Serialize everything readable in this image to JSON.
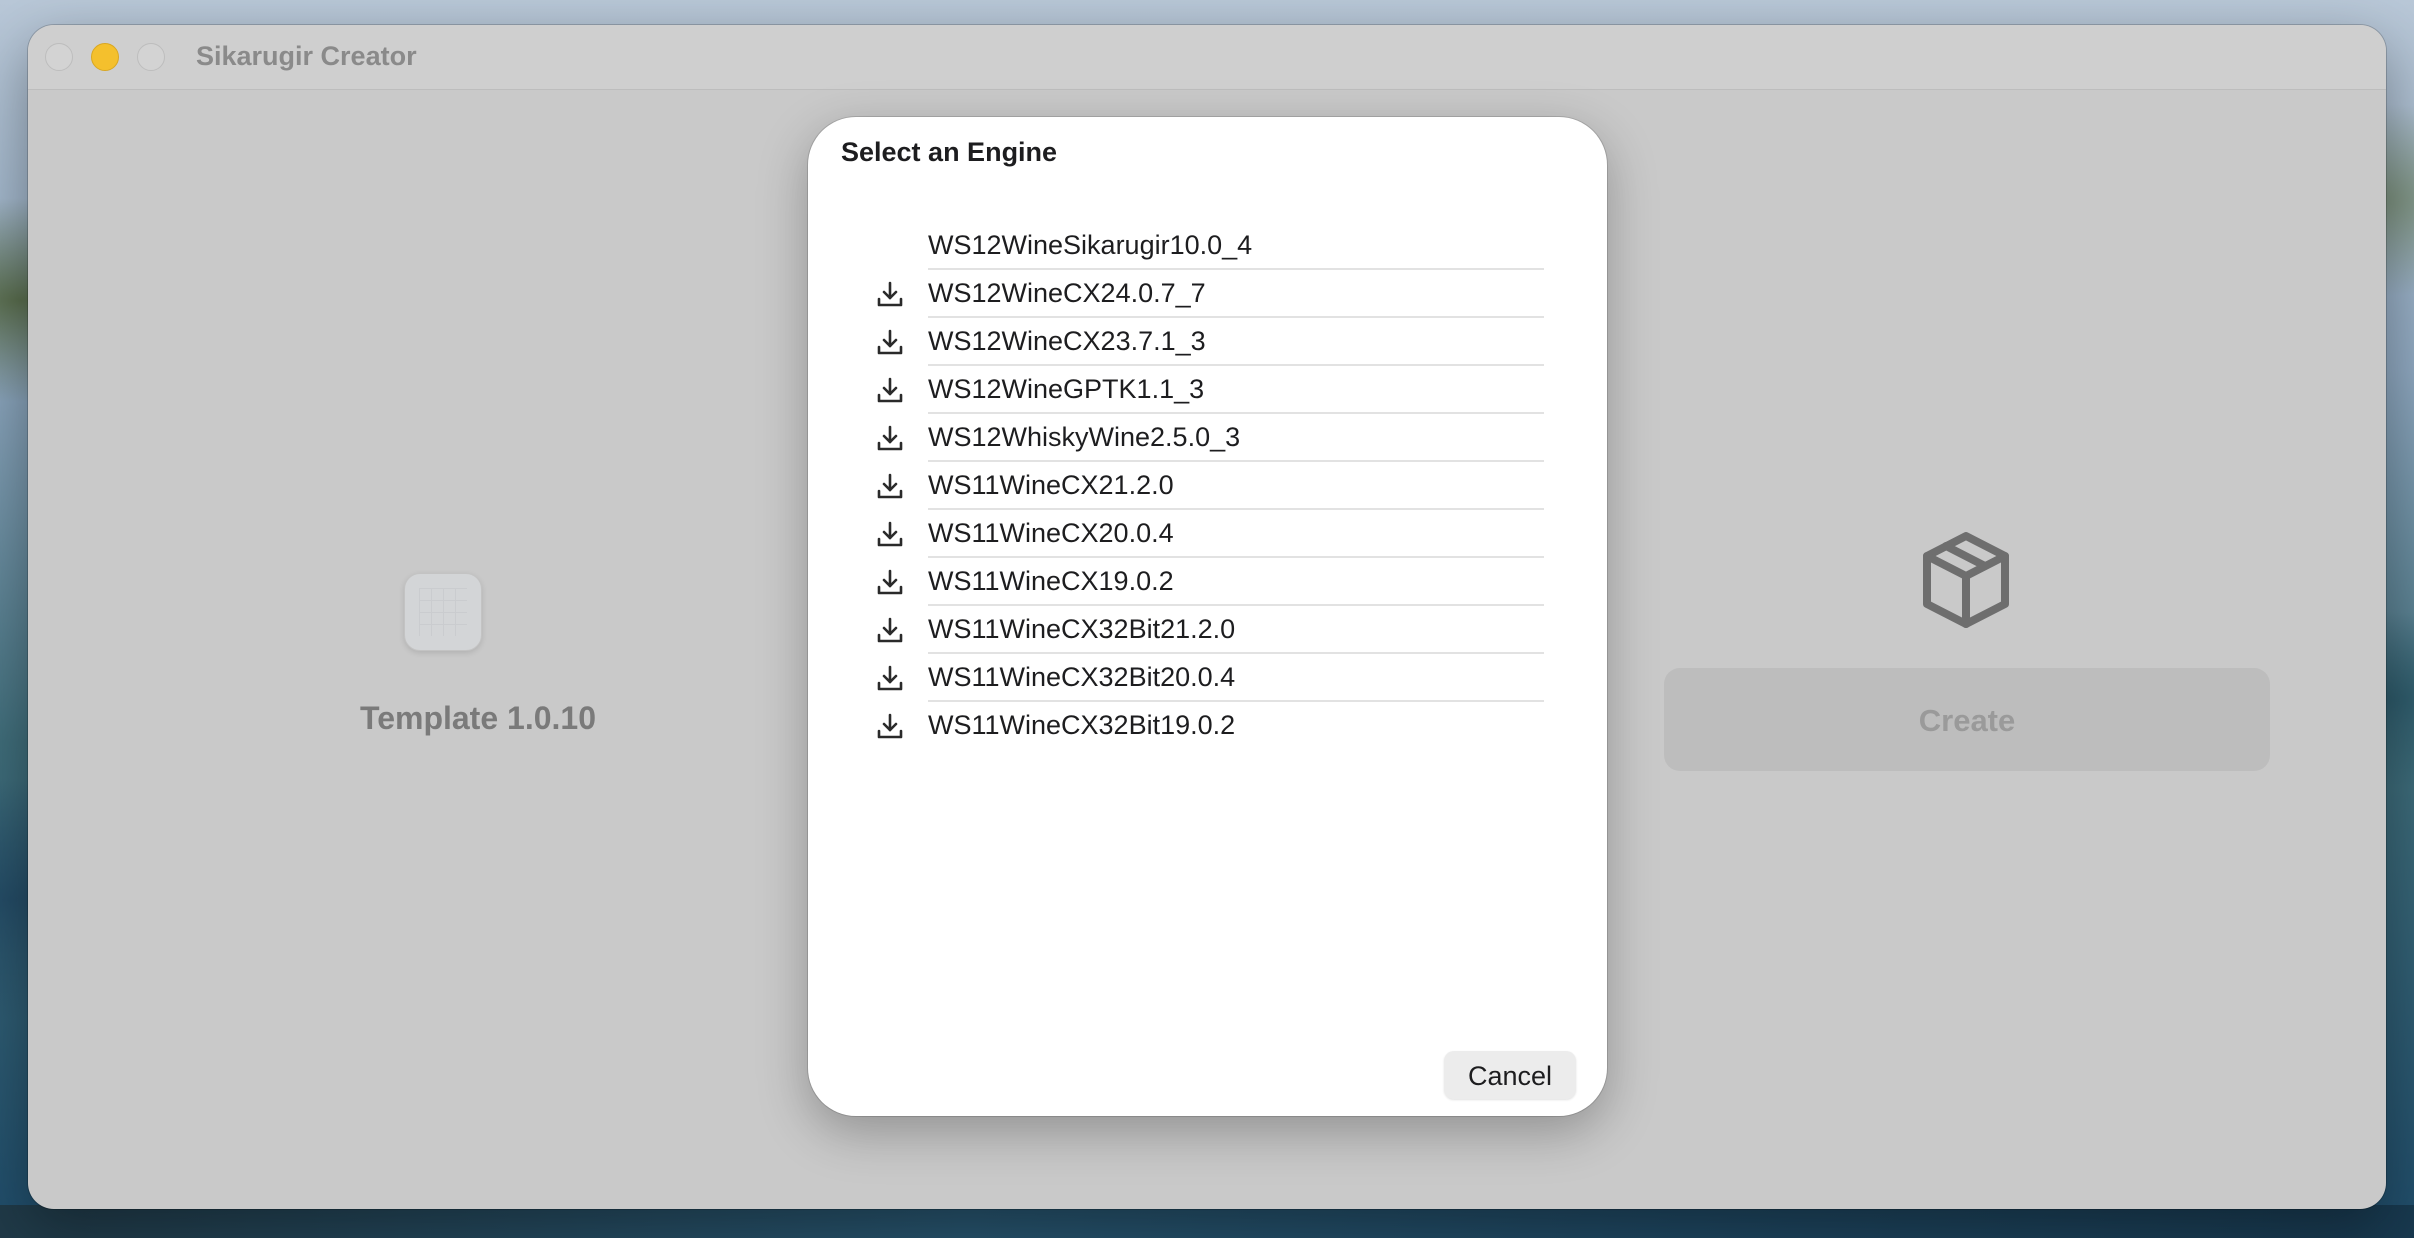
{
  "window": {
    "title": "Sikarugir Creator"
  },
  "left_panel": {
    "template_label": "Template 1.0.10",
    "icon": "template-grid-icon"
  },
  "right_panel": {
    "icon": "package-box-icon",
    "create_label": "Create"
  },
  "sheet": {
    "title": "Select an Engine",
    "cancel_label": "Cancel",
    "engines": [
      {
        "name": "WS12WineSikarugir10.0_4",
        "download_icon": false
      },
      {
        "name": "WS12WineCX24.0.7_7",
        "download_icon": true
      },
      {
        "name": "WS12WineCX23.7.1_3",
        "download_icon": true
      },
      {
        "name": "WS12WineGPTK1.1_3",
        "download_icon": true
      },
      {
        "name": "WS12WhiskyWine2.5.0_3",
        "download_icon": true
      },
      {
        "name": "WS11WineCX21.2.0",
        "download_icon": true
      },
      {
        "name": "WS11WineCX20.0.4",
        "download_icon": true
      },
      {
        "name": "WS11WineCX19.0.2",
        "download_icon": true
      },
      {
        "name": "WS11WineCX32Bit21.2.0",
        "download_icon": true
      },
      {
        "name": "WS11WineCX32Bit20.0.4",
        "download_icon": true
      },
      {
        "name": "WS11WineCX32Bit19.0.2",
        "download_icon": true
      }
    ]
  },
  "colors": {
    "minimize_button": "#f4c02d",
    "window_background": "#c9c9c9",
    "sheet_background": "#ffffff"
  }
}
